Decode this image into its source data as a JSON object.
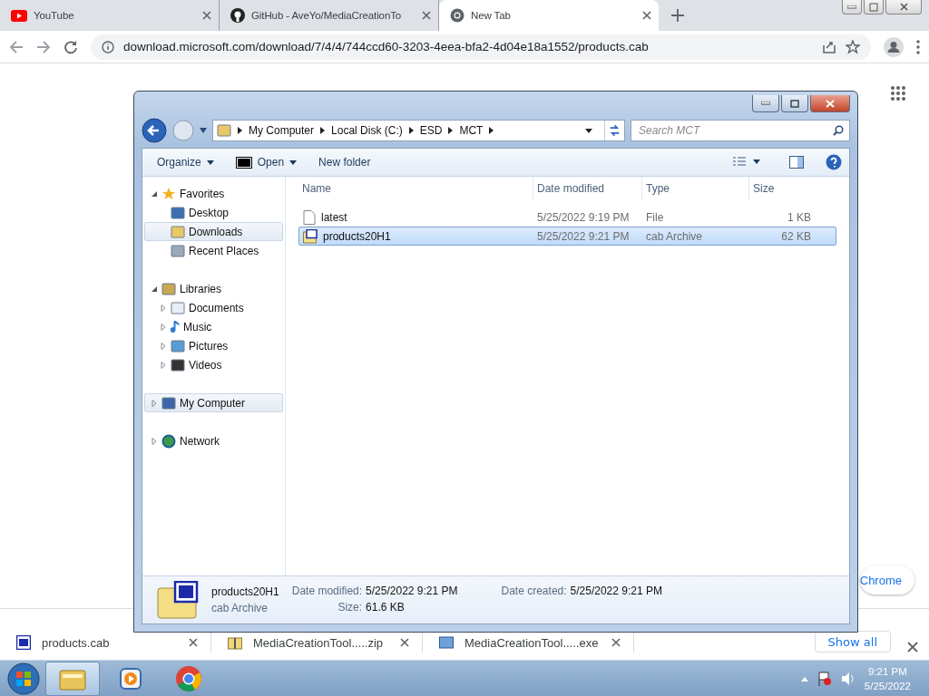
{
  "browser": {
    "tabs": [
      {
        "title": "YouTube",
        "selected": false
      },
      {
        "title": "GitHub - AveYo/MediaCreationTo",
        "selected": false
      },
      {
        "title": "New Tab",
        "selected": true
      }
    ],
    "address": "download.microsoft.com/download/7/4/4/744ccd60-3203-4eea-bfa2-4d04e18a1552/products.cab"
  },
  "page": {
    "customize_button": "Chrome"
  },
  "downloads": {
    "items": [
      {
        "name": "products.cab"
      },
      {
        "name": "MediaCreationTool.....zip"
      },
      {
        "name": "MediaCreationTool.....exe"
      }
    ],
    "show_all": "Show all"
  },
  "explorer": {
    "path": [
      "My Computer",
      "Local Disk (C:)",
      "ESD",
      "MCT"
    ],
    "search_placeholder": "Search MCT",
    "toolbar": [
      {
        "label": "Organize",
        "kind": "menu"
      },
      {
        "label": "Open",
        "kind": "open"
      },
      {
        "label": "New folder",
        "kind": "plain"
      }
    ],
    "nav": [
      {
        "label": "Favorites",
        "expanded": true,
        "selected": false,
        "children": [
          {
            "label": "Desktop",
            "selected": false
          },
          {
            "label": "Downloads",
            "selected": true
          },
          {
            "label": "Recent Places",
            "selected": false
          }
        ]
      },
      {
        "label": "Libraries",
        "expanded": true,
        "selected": false,
        "children": [
          {
            "label": "Documents",
            "expanded": false,
            "selected": false
          },
          {
            "label": "Music",
            "expanded": false,
            "selected": false
          },
          {
            "label": "Pictures",
            "expanded": false,
            "selected": false
          },
          {
            "label": "Videos",
            "expanded": false,
            "selected": false
          }
        ]
      },
      {
        "label": "My Computer",
        "expanded": false,
        "selected": true
      },
      {
        "label": "Network",
        "expanded": false,
        "selected": false
      }
    ],
    "columns": [
      "Name",
      "Date modified",
      "Type",
      "Size"
    ],
    "files": [
      {
        "name": "latest",
        "kind": "file",
        "date": "5/25/2022 9:19 PM",
        "type": "File",
        "size": "1 KB",
        "selected": false
      },
      {
        "name": "products20H1",
        "kind": "cab",
        "date": "5/25/2022 9:21 PM",
        "type": "cab Archive",
        "size": "62 KB",
        "selected": true
      }
    ],
    "details": {
      "name": "products20H1",
      "type": "cab Archive",
      "fields": [
        {
          "label": "Date modified:",
          "value": "5/25/2022 9:21 PM"
        },
        {
          "label": "Date created:",
          "value": "5/25/2022 9:21 PM"
        },
        {
          "label": "Size:",
          "value": "61.6 KB"
        }
      ]
    }
  },
  "taskbar": {
    "apps": [
      {
        "active": true
      },
      {
        "active": false
      },
      {
        "active": false
      }
    ],
    "time": "9:21 PM",
    "date": "5/25/2022"
  }
}
